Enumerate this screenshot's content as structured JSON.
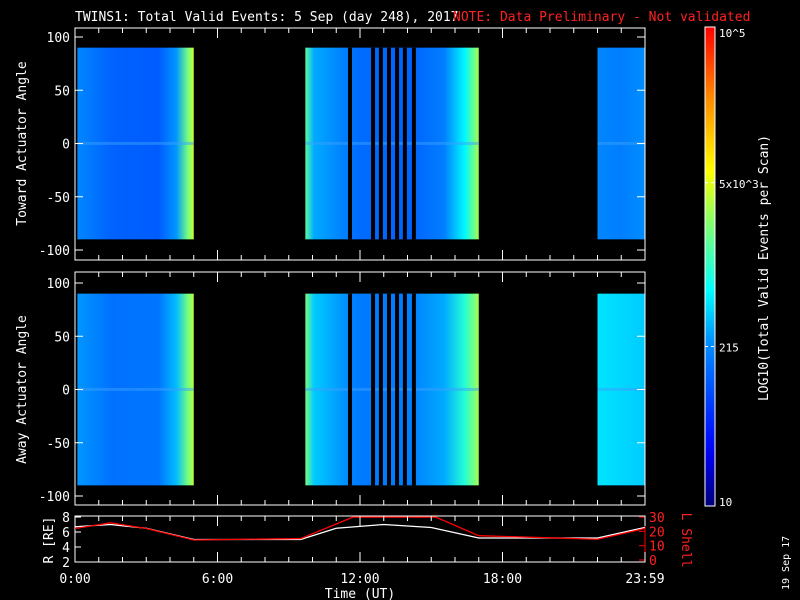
{
  "title": "TWINS1: Total Valid Events:  5 Sep (day 248), 2017",
  "note": "NOTE: Data Preliminary - Not validated",
  "date_stamp": "19 Sep 17",
  "chart_data": [
    {
      "type": "heatmap",
      "panel": "toward",
      "ylabel": "Toward Actuator Angle",
      "ylim": [
        -110,
        110
      ],
      "yticks": [
        "100",
        "50",
        "0",
        "-50",
        "-100"
      ],
      "data_range": [
        -90,
        90
      ],
      "blocks": [
        {
          "start": 0.1,
          "end": 5.0,
          "stops": [
            [
              0,
              200
            ],
            [
              0.3,
              120
            ],
            [
              0.7,
              110
            ],
            [
              0.85,
              250
            ],
            [
              0.95,
              2000
            ],
            [
              1,
              4000
            ]
          ]
        },
        {
          "start": 9.7,
          "end": 17.0,
          "stops": [
            [
              0,
              1500
            ],
            [
              0.05,
              300
            ],
            [
              0.3,
              140
            ],
            [
              0.6,
              120
            ],
            [
              0.8,
              180
            ],
            [
              0.92,
              600
            ],
            [
              1,
              3000
            ]
          ]
        },
        {
          "start": 22.0,
          "end": 23.99,
          "stops": [
            [
              0,
              200
            ],
            [
              0.5,
              180
            ],
            [
              1,
              220
            ]
          ]
        }
      ],
      "gaps": [
        11.58,
        12.55,
        12.88,
        13.22,
        13.56,
        13.89,
        14.27
      ]
    },
    {
      "type": "heatmap",
      "panel": "away",
      "ylabel": "Away Actuator Angle",
      "ylim": [
        -110,
        110
      ],
      "yticks": [
        "100",
        "50",
        "0",
        "-50",
        "-100"
      ],
      "data_range": [
        -90,
        90
      ],
      "blocks": [
        {
          "start": 0.1,
          "end": 5.0,
          "stops": [
            [
              0,
              250
            ],
            [
              0.3,
              150
            ],
            [
              0.7,
              160
            ],
            [
              0.85,
              350
            ],
            [
              0.95,
              2000
            ],
            [
              1,
              3500
            ]
          ]
        },
        {
          "start": 9.7,
          "end": 17.0,
          "stops": [
            [
              0,
              2000
            ],
            [
              0.05,
              400
            ],
            [
              0.3,
              170
            ],
            [
              0.6,
              180
            ],
            [
              0.8,
              300
            ],
            [
              0.92,
              900
            ],
            [
              1,
              3000
            ]
          ]
        },
        {
          "start": 22.0,
          "end": 23.99,
          "stops": [
            [
              0,
              500
            ],
            [
              0.5,
              450
            ],
            [
              1,
              400
            ]
          ]
        }
      ],
      "gaps": [
        11.58,
        12.55,
        12.88,
        13.22,
        13.56,
        13.89,
        14.27
      ]
    },
    {
      "type": "line",
      "panel": "orbit",
      "ylabel": "R [RE]",
      "y2label": "L Shell",
      "xlabel": "Time (UT)",
      "xticks": [
        "0:00",
        "6:00",
        "12:00",
        "18:00",
        "23:59"
      ],
      "yticks": [
        "8",
        "6",
        "4",
        "2"
      ],
      "y2ticks": [
        "30",
        "20",
        "10",
        "0"
      ],
      "ylim": [
        1.5,
        8
      ],
      "y2lim": [
        0,
        30
      ],
      "series": [
        {
          "name": "R",
          "color": "#ffffff",
          "x": [
            0,
            1.5,
            3,
            5,
            9.5,
            11,
            13,
            15,
            17,
            22,
            23.99
          ],
          "values": [
            6.7,
            7.0,
            6.5,
            5.0,
            5.0,
            6.5,
            7.0,
            6.6,
            5.2,
            5.2,
            6.6
          ]
        },
        {
          "name": "L Shell",
          "color": "#ff0000",
          "x": [
            0,
            1.5,
            3,
            5,
            9.5,
            11.7,
            15.2,
            17,
            22,
            23.99
          ],
          "values": [
            22,
            26,
            22,
            14,
            15,
            30,
            30,
            17,
            14.5,
            22
          ]
        }
      ]
    }
  ],
  "colorbar": {
    "label": "LOG10(Total Valid Events per Scan)",
    "min": 10,
    "max": 100000,
    "ticks": [
      {
        "value": 100000,
        "label": "10^5"
      },
      {
        "value": 5000,
        "label": "5x10^3"
      },
      {
        "value": 215,
        "label": "215"
      },
      {
        "value": 10,
        "label": "10"
      }
    ]
  }
}
